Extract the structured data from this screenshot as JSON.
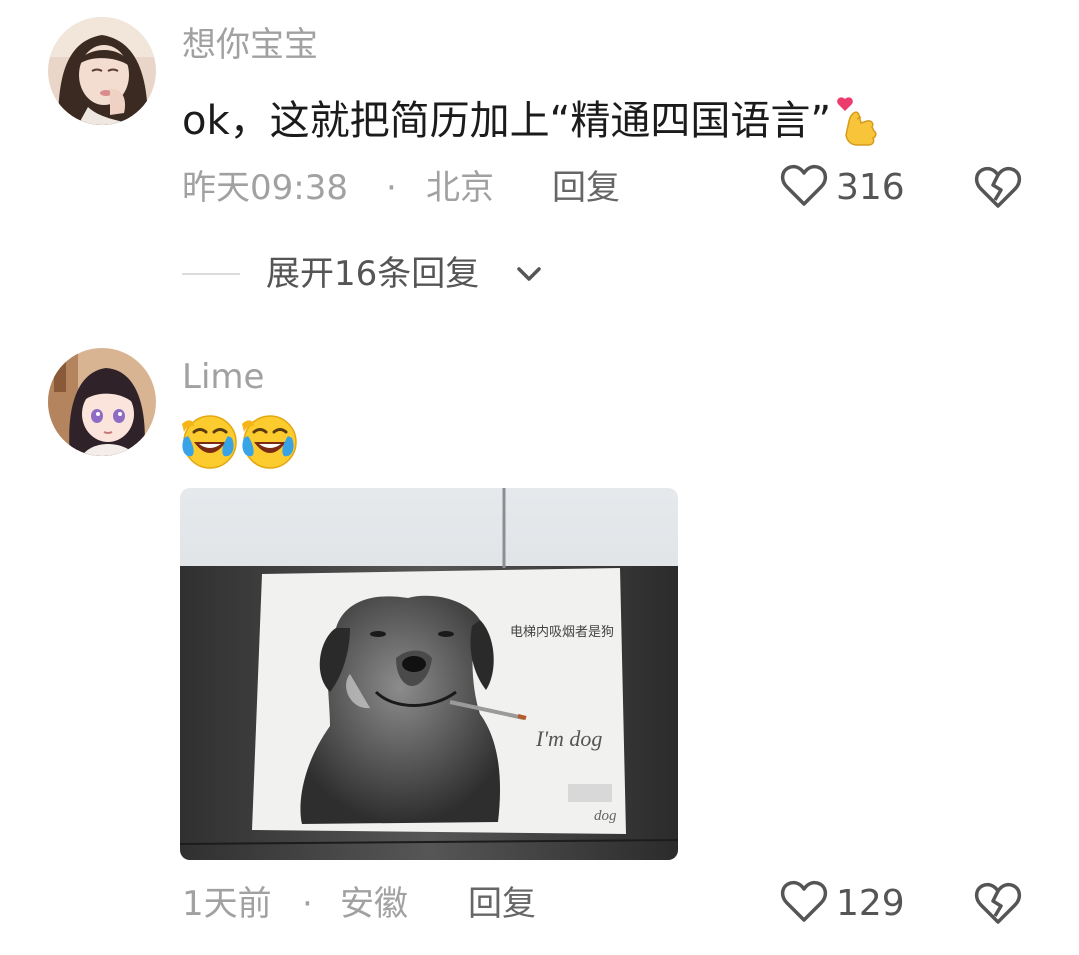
{
  "comments": [
    {
      "username": "想你宝宝",
      "text": "ok，这就把简历加上“精通四国语言”",
      "emoji_icon": "finger-heart-icon",
      "time": "昨天09:38",
      "separator": "·",
      "location": "北京",
      "reply_label": "回复",
      "likes": "316",
      "expand_label": "展开16条回复"
    },
    {
      "username": "Lime",
      "emoji_icons": [
        "laughing-crying-icon",
        "laughing-crying-icon"
      ],
      "photo": {
        "sign_text": "电梯内吸烟者是狗",
        "handwriting_1": "I'm dog",
        "handwriting_2": "dog"
      },
      "time": "1天前",
      "separator": "·",
      "location": "安徽",
      "reply_label": "回复",
      "likes": "129"
    }
  ],
  "colors": {
    "meta_gray": "#a1a1a1",
    "text_dark": "#1b1b1b",
    "icon_gray": "#555555"
  }
}
